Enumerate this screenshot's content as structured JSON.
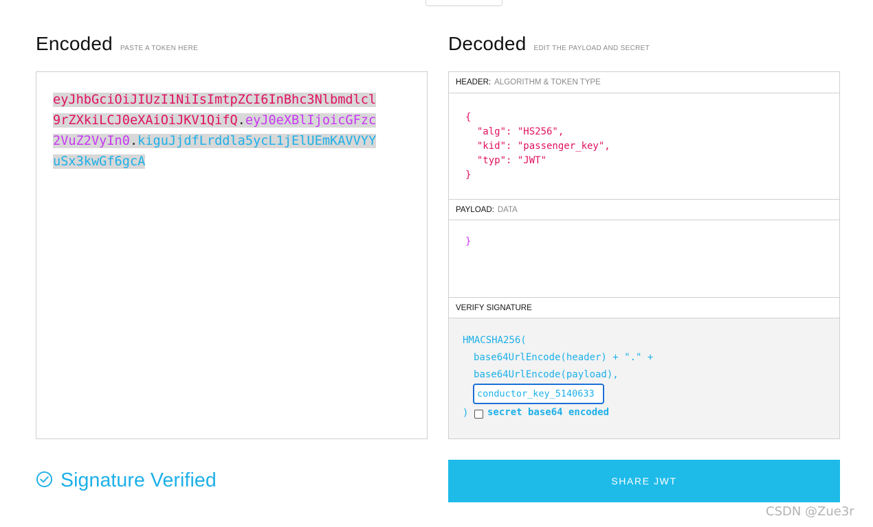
{
  "encoded": {
    "title": "Encoded",
    "subtitle": "PASTE A TOKEN HERE",
    "token_header": "eyJhbGciOiJIUzI1NiIsImtpZCI6InBhc3Nlbmdlcl9rZXkiLCJ0eXAiOiJKV1QifQ",
    "dot1": ".",
    "token_payload": "eyJ0eXBlIjoicGFzc2VuZ2VyIn0",
    "dot2": ".",
    "token_signature": "kiguJjdfLrddla5ycL1jElUEmKAVVYYuSx3kwGf6gcA"
  },
  "decoded": {
    "title": "Decoded",
    "subtitle": "EDIT THE PAYLOAD AND SECRET",
    "header_label": "HEADER:",
    "header_sub": "ALGORITHM & TOKEN TYPE",
    "header_json": "{\n  \"alg\": \"HS256\",\n  \"kid\": \"passenger_key\",\n  \"typ\": \"JWT\"\n}",
    "payload_label": "PAYLOAD:",
    "payload_sub": "DATA",
    "payload_json": "}",
    "verify_label": "VERIFY SIGNATURE",
    "verify_line1": "HMACSHA256(",
    "verify_line2": "base64UrlEncode(header) + \".\" +",
    "verify_line3": "base64UrlEncode(payload),",
    "secret_value": "conductor_key_5140633",
    "verify_close": ")",
    "secret_b64_label": "secret base64 encoded"
  },
  "status": {
    "verified_text": "Signature Verified",
    "icon": "check-circle-icon"
  },
  "share_button": "SHARE JWT",
  "watermark": "CSDN @Zue3r",
  "colors": {
    "header": "#e0115f",
    "payload": "#c837f2",
    "signature": "#1db0e8",
    "button": "#1ebbe9"
  }
}
